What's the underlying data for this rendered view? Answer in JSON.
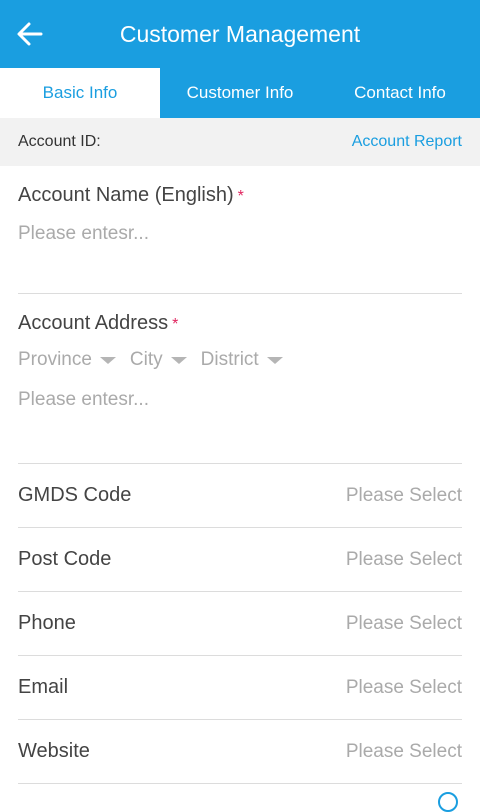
{
  "header": {
    "title": "Customer Management"
  },
  "tabs": [
    {
      "label": "Basic Info"
    },
    {
      "label": "Customer Info"
    },
    {
      "label": "Contact Info"
    }
  ],
  "account": {
    "id_label": "Account ID:",
    "report_link": "Account Report"
  },
  "account_name": {
    "label": "Account Name (English)",
    "required": "*",
    "placeholder": "Please entesr..."
  },
  "account_address": {
    "label": "Account Address",
    "required": "*",
    "province": "Province",
    "city": "City",
    "district": "District",
    "placeholder": "Please entesr..."
  },
  "rows": [
    {
      "label": "GMDS Code",
      "value": "Please Select"
    },
    {
      "label": "Post Code",
      "value": "Please Select"
    },
    {
      "label": "Phone",
      "value": "Please Select"
    },
    {
      "label": "Email",
      "value": "Please Select"
    },
    {
      "label": "Website",
      "value": "Please Select"
    }
  ],
  "colors": {
    "primary": "#1a9ee0",
    "required": "#e0245e"
  }
}
